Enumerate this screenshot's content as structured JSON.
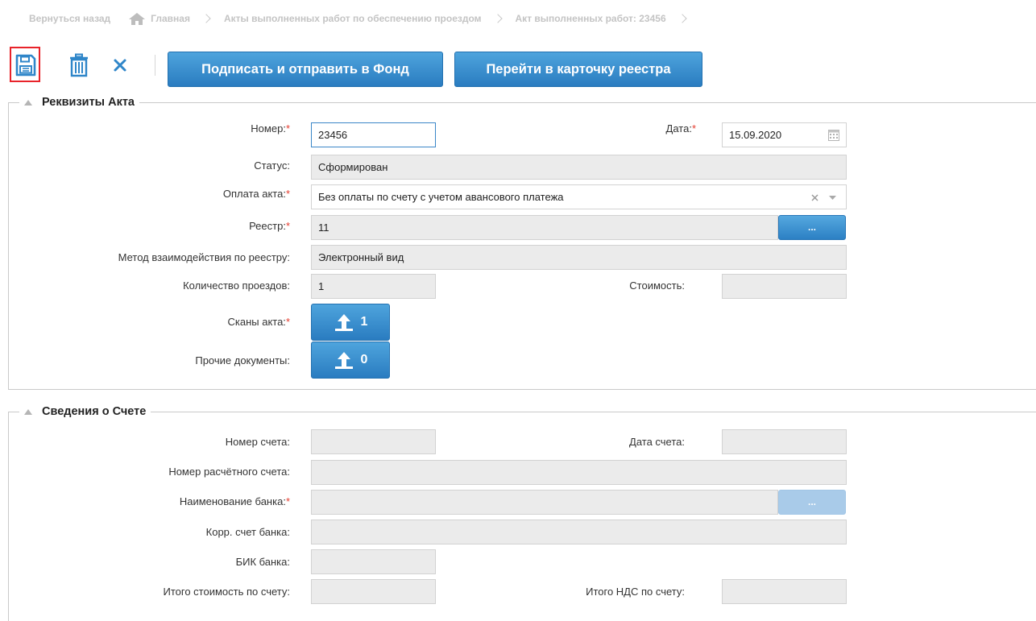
{
  "breadcrumb": {
    "back": "Вернуться назад",
    "home": "Главная",
    "acts_list": "Акты выполненных работ по обеспечению проездом",
    "current": "Акт выполненных работ: 23456"
  },
  "toolbar": {
    "sign_send_label": "Подписать и отправить в Фонд",
    "registry_card_label": "Перейти в карточку реестра"
  },
  "act_section": {
    "title": "Реквизиты Акта",
    "number_label": "Номер:",
    "number_value": "23456",
    "date_label": "Дата:",
    "date_value": "15.09.2020",
    "status_label": "Статус:",
    "status_value": "Сформирован",
    "payment_label": "Оплата акта:",
    "payment_value": "Без оплаты по счету с учетом авансового платежа",
    "registry_label": "Реестр:",
    "registry_value": "11",
    "method_label": "Метод взаимодействия по реестру:",
    "method_value": "Электронный вид",
    "trips_label": "Количество проездов:",
    "trips_value": "1",
    "cost_label": "Стоимость:",
    "cost_value": "",
    "scans_label": "Сканы акта:",
    "scans_count": "1",
    "other_docs_label": "Прочие документы:",
    "other_docs_count": "0",
    "dots": "..."
  },
  "invoice_section": {
    "title": "Сведения о Счете",
    "invoice_number_label": "Номер счета:",
    "invoice_date_label": "Дата счета:",
    "account_label": "Номер расчётного счета:",
    "bank_name_label": "Наименование банка:",
    "corr_account_label": "Корр. счет банка:",
    "bik_label": "БИК банка:",
    "total_cost_label": "Итого стоимость по счету:",
    "total_vat_label": "Итого НДС по счету:",
    "dots": "..."
  },
  "required_mark": "*",
  "colors": {
    "accent": "#2f86c9",
    "required": "#e53a2d",
    "highlight": "#e8232a"
  }
}
